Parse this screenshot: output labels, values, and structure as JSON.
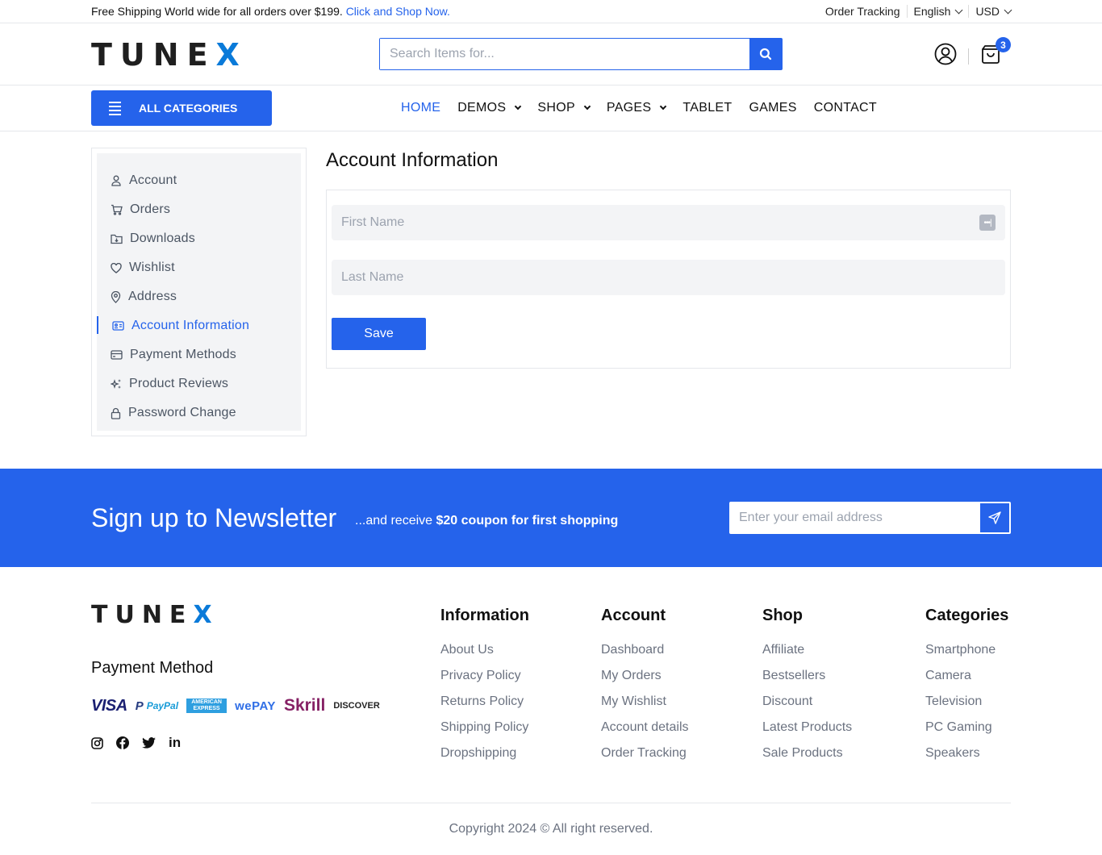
{
  "topbar": {
    "promo_text": "Free Shipping World wide for all orders over $199.",
    "promo_link": "Click and Shop Now.",
    "order_tracking": "Order Tracking",
    "language": "English",
    "currency": "USD"
  },
  "header": {
    "logo_main": "TUNE",
    "logo_accent": "X",
    "search_placeholder": "Search Items for...",
    "cart_count": "3"
  },
  "nav": {
    "all_categories": "ALL CATEGORIES",
    "items": [
      {
        "label": "HOME",
        "active": true,
        "dropdown": false
      },
      {
        "label": "DEMOS",
        "dropdown": true
      },
      {
        "label": "SHOP",
        "dropdown": true
      },
      {
        "label": "PAGES",
        "dropdown": true
      },
      {
        "label": "TABLET",
        "dropdown": false
      },
      {
        "label": "GAMES",
        "dropdown": false
      },
      {
        "label": "CONTACT",
        "dropdown": false
      }
    ]
  },
  "sidebar": {
    "items": [
      {
        "label": "Account",
        "icon": "user-icon"
      },
      {
        "label": "Orders",
        "icon": "cart-icon"
      },
      {
        "label": "Downloads",
        "icon": "folder-download-icon"
      },
      {
        "label": "Wishlist",
        "icon": "heart-icon"
      },
      {
        "label": "Address",
        "icon": "map-pin-icon"
      },
      {
        "label": "Account Information",
        "icon": "id-card-icon",
        "active": true
      },
      {
        "label": "Payment Methods",
        "icon": "credit-card-icon"
      },
      {
        "label": "Product Reviews",
        "icon": "sparkles-icon"
      },
      {
        "label": "Password Change",
        "icon": "lock-icon"
      }
    ]
  },
  "main": {
    "title": "Account Information",
    "first_name_placeholder": "First Name",
    "first_name_value": "",
    "last_name_placeholder": "Last Name",
    "last_name_value": "",
    "save_label": "Save"
  },
  "newsletter": {
    "title": "Sign up to Newsletter",
    "sub_prefix": "...and receive ",
    "sub_bold": "$20 coupon for first shopping",
    "email_placeholder": "Enter your email address"
  },
  "footer": {
    "logo_main": "TUNE",
    "logo_accent": "X",
    "payment_title": "Payment Method",
    "payments": [
      "VISA",
      "PayPal",
      "AMERICAN EXPRESS",
      "wePAY",
      "Skrill",
      "DISCOVER"
    ],
    "socials": [
      "instagram",
      "facebook",
      "twitter",
      "linkedin"
    ],
    "columns": [
      {
        "title": "Information",
        "links": [
          "About Us",
          "Privacy Policy",
          "Returns Policy",
          "Shipping Policy",
          "Dropshipping"
        ]
      },
      {
        "title": "Account",
        "links": [
          "Dashboard",
          "My Orders",
          "My Wishlist",
          "Account details",
          "Order Tracking"
        ]
      },
      {
        "title": "Shop",
        "links": [
          "Affiliate",
          "Bestsellers",
          "Discount",
          "Latest Products",
          "Sale Products"
        ]
      },
      {
        "title": "Categories",
        "links": [
          "Smartphone",
          "Camera",
          "Television",
          "PC Gaming",
          "Speakers"
        ]
      }
    ],
    "copyright": "Copyright 2024 © All right reserved."
  },
  "colors": {
    "accent": "#2563eb",
    "logo_accent": "#0a7ad9",
    "sidebar_bg": "#f3f4f6",
    "muted_text": "#6b7280"
  }
}
